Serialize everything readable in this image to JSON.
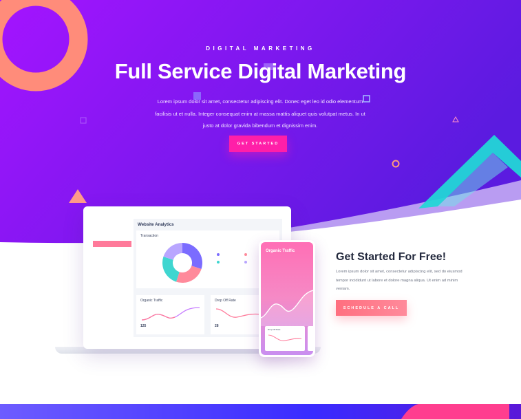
{
  "hero": {
    "eyebrow": "DIGITAL MARKETING",
    "title": "Full Service Digital Marketing",
    "lead": "Lorem ipsum dolor sit amet, consectetur adipiscing elit. Donec eget leo id odio elementum facilisis ut et nulla. Integer consequat enim at massa mattis aliquet quis volutpat metus. In ut justo at dolor gravida bibendum et dignissim enim.",
    "button_label": "GET STARTED"
  },
  "colors": {
    "hero_gradient_start": "#a414ff",
    "hero_gradient_end": "#5b1be0",
    "primary_button": "#ff1fa8",
    "cta_button": "#ff7a8a",
    "accent_teal": "#23d6d6",
    "accent_coral": "#ff8c7a"
  },
  "dashboard": {
    "title": "Website Analytics",
    "sidebar_items": [
      "",
      "",
      "",
      "",
      "",
      ""
    ],
    "transaction": {
      "title": "Transaction",
      "subtitle": "",
      "legend": [
        "",
        "",
        "",
        ""
      ],
      "donut_percent": [
        30,
        25,
        25,
        20
      ]
    },
    "organic_traffic": {
      "title": "Organic Traffic",
      "value": "125",
      "label": ""
    },
    "drop_off_rate": {
      "title": "Drop Off Rate",
      "value": "28",
      "label": ""
    }
  },
  "phone": {
    "title": "Organic Traffic",
    "subtitle": "",
    "card_title": "Drop Off Rate"
  },
  "cta": {
    "title": "Get Started For Free!",
    "text": "Lorem ipsum dolor sit amet, consectetur adipiscing elit, sed do eiusmod tempor incididunt ut labore et dolore magna aliqua. Ut enim ad minim veniam.",
    "button_label": "SCHEDULE A CALL"
  }
}
